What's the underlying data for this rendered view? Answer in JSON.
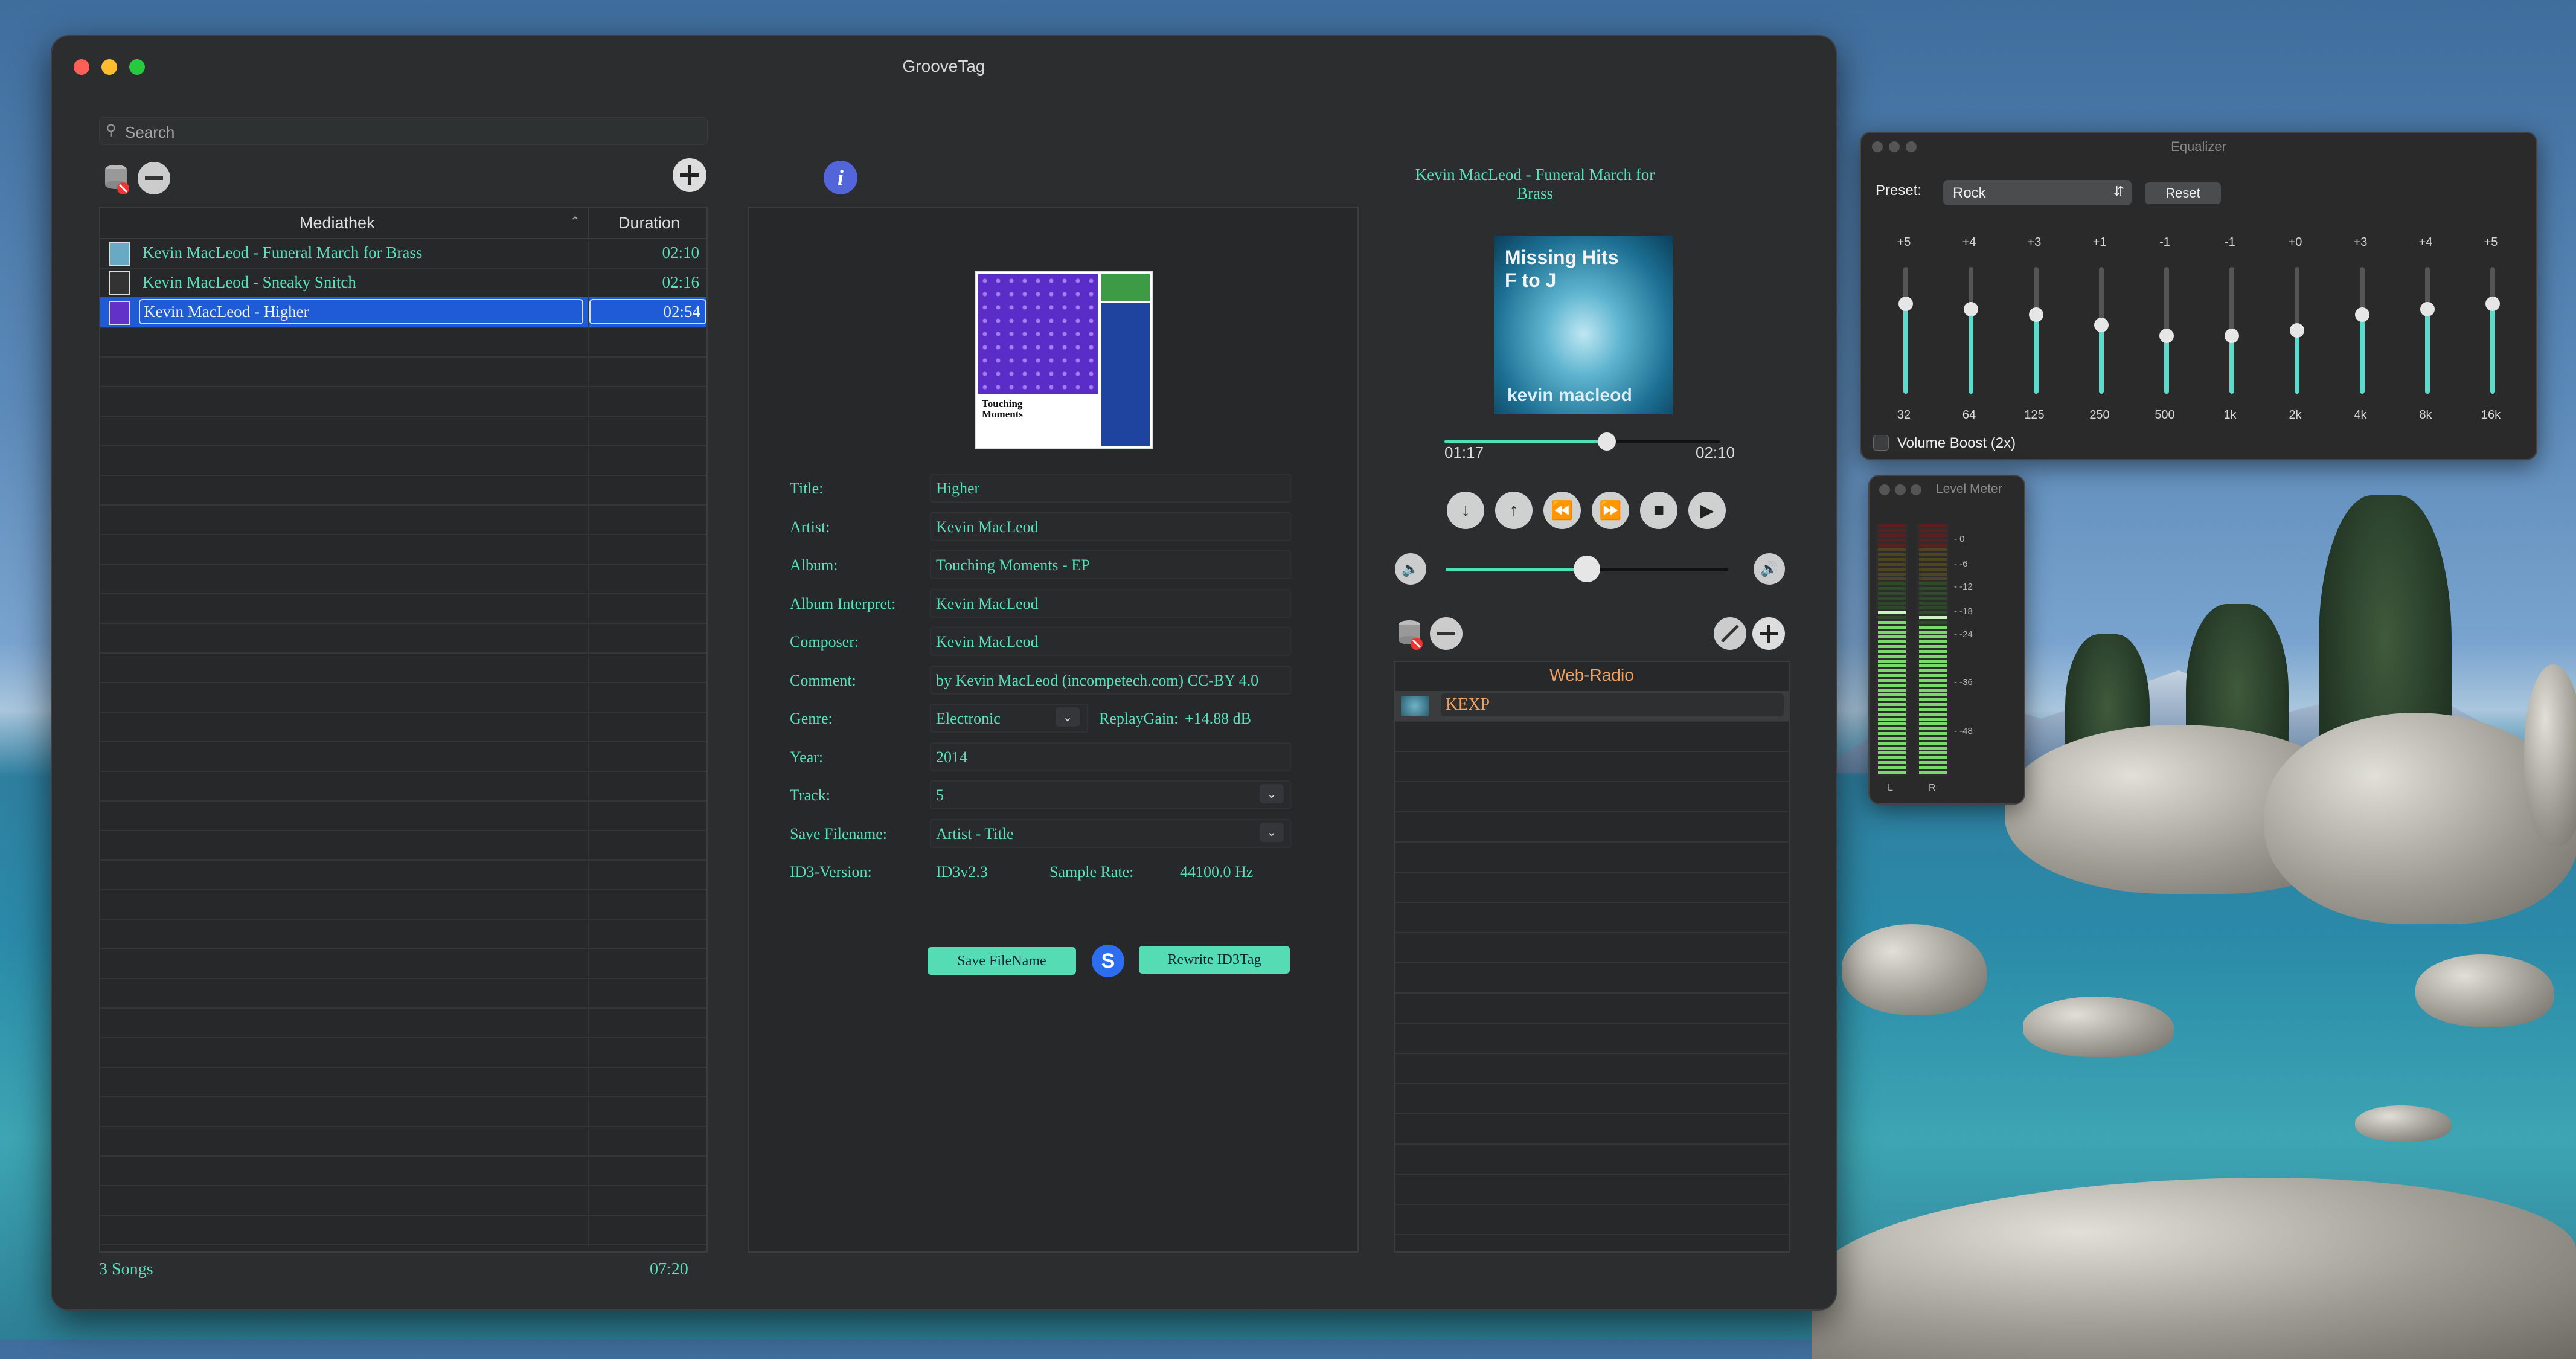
{
  "app_title": "GrooveTag",
  "search_placeholder": "Search",
  "library": {
    "col_title": "Mediathek",
    "col_duration": "Duration",
    "rows": [
      {
        "title": "Kevin MacLeod - Funeral March for Brass",
        "duration": "02:10",
        "selected": false
      },
      {
        "title": "Kevin MacLeod - Sneaky Snitch",
        "duration": "02:16",
        "selected": false
      },
      {
        "title": "Kevin MacLeod - Higher",
        "duration": "02:54",
        "selected": true
      }
    ],
    "footer_count": "3 Songs",
    "footer_total": "07:20"
  },
  "cover_text": "Touching Moments",
  "tags": {
    "title_label": "Title:",
    "title": "Higher",
    "artist_label": "Artist:",
    "artist": "Kevin MacLeod",
    "album_label": "Album:",
    "album": "Touching Moments - EP",
    "album_interpret_label": "Album Interpret:",
    "album_interpret": "Kevin MacLeod",
    "composer_label": "Composer:",
    "composer": "Kevin MacLeod",
    "comment_label": "Comment:",
    "comment": "by Kevin MacLeod (incompetech.com) CC-BY 4.0",
    "genre_label": "Genre:",
    "genre": "Electronic",
    "replaygain_label": "ReplayGain:",
    "replaygain": "+14.88 dB",
    "year_label": "Year:",
    "year": "2014",
    "track_label": "Track:",
    "track": "5",
    "save_filename_label": "Save Filename:",
    "save_filename": "Artist - Title",
    "id3_label": "ID3-Version:",
    "id3": "ID3v2.3",
    "samplerate_label": "Sample Rate:",
    "samplerate": "44100.0 Hz",
    "save_button": "Save FileName",
    "rewrite_button": "Rewrite ID3Tag"
  },
  "player": {
    "now_playing": "Kevin MacLeod - Funeral March for Brass",
    "art_line1": "Missing Hits",
    "art_line2": "F to J",
    "art_artist": "kevin macleod",
    "elapsed": "01:17",
    "total": "02:10",
    "progress": 0.59,
    "volume": 0.5
  },
  "radio": {
    "header": "Web-Radio",
    "stations": [
      "KEXP"
    ]
  },
  "equalizer": {
    "title": "Equalizer",
    "preset_label": "Preset:",
    "preset": "Rock",
    "reset": "Reset",
    "bands": [
      {
        "freq": "32",
        "gain": "+5",
        "g": 5
      },
      {
        "freq": "64",
        "gain": "+4",
        "g": 4
      },
      {
        "freq": "125",
        "gain": "+3",
        "g": 3
      },
      {
        "freq": "250",
        "gain": "+1",
        "g": 1
      },
      {
        "freq": "500",
        "gain": "-1",
        "g": -1
      },
      {
        "freq": "1k",
        "gain": "-1",
        "g": -1
      },
      {
        "freq": "2k",
        "gain": "+0",
        "g": 0
      },
      {
        "freq": "4k",
        "gain": "+3",
        "g": 3
      },
      {
        "freq": "8k",
        "gain": "+4",
        "g": 4
      },
      {
        "freq": "16k",
        "gain": "+5",
        "g": 5
      }
    ],
    "boost_label": "Volume Boost (2x)"
  },
  "level_meter": {
    "title": "Level Meter",
    "scale": [
      "0",
      "-6",
      "-12",
      "-18",
      "-24",
      "-36",
      "-48"
    ],
    "left": "L",
    "right": "R",
    "level_l": 0.62,
    "level_r": 0.6
  },
  "colors": {
    "accent": "#4fe0b8",
    "selection": "#1f5bd6",
    "window": "#2b2d2e"
  }
}
